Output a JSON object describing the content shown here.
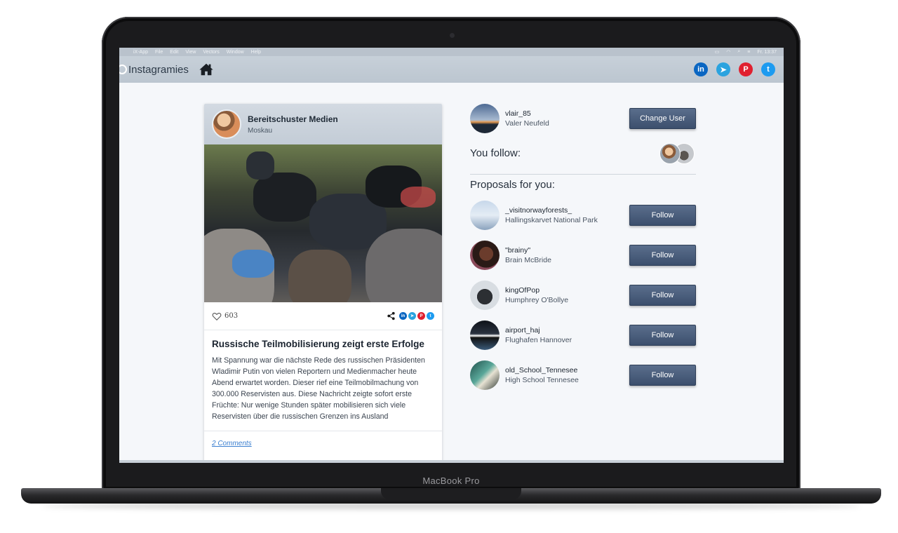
{
  "device": {
    "label": "MacBook Pro"
  },
  "menubar": {
    "items": [
      "iX-App",
      "File",
      "Edit",
      "View",
      "Vectors",
      "Window",
      "Help"
    ],
    "clock": "Fr. 13:37"
  },
  "navbar": {
    "brand": "Instagramies",
    "icons": [
      "home-icon"
    ],
    "social": [
      {
        "name": "linkedin",
        "glyph": "in",
        "color": "#0a66c2"
      },
      {
        "name": "telegram",
        "glyph": "➤",
        "color": "#2aa3df"
      },
      {
        "name": "pinterest",
        "glyph": "P",
        "color": "#e0202f"
      },
      {
        "name": "twitter",
        "glyph": "t",
        "color": "#1d9bf0"
      }
    ]
  },
  "post": {
    "author": "Bereitschuster Medien",
    "location": "Moskau",
    "likes": "603",
    "title": "Russische Teilmobilisierung zeigt erste Erfolge",
    "text": "Mit Spannung war die nächste Rede des russischen Präsidenten Wladimir Putin von vielen Reportern und Medienmacher heute Abend erwartet worden. Dieser rief eine Teilmobilmachung von 300.000 Reservisten aus. Diese Nachricht zeigte sofort erste Früchte: Nur wenige Stunden später mobilisieren sich viele Reservisten über die russischen Grenzen ins Ausland",
    "comments": "2 Comments"
  },
  "current_user": {
    "username": "vlair_85",
    "full_name": "Valer Neufeld",
    "button": "Change User"
  },
  "you_follow": {
    "title": "You follow:"
  },
  "proposals": {
    "title": "Proposals for you:",
    "button": "Follow",
    "items": [
      {
        "username": "_visitnorwayforests_",
        "full_name": "Hallingskarvet National Park"
      },
      {
        "username": "\"brainy\"",
        "full_name": "Brain McBride"
      },
      {
        "username": "kingOfPop",
        "full_name": "Humphrey O'Bollye"
      },
      {
        "username": "airport_haj",
        "full_name": "Flughafen Hannover"
      },
      {
        "username": "old_School_Tennesee",
        "full_name": "High School Tennesee"
      }
    ]
  },
  "colors": {
    "accent": "#44577a",
    "navbar": "#c3ccd6"
  }
}
